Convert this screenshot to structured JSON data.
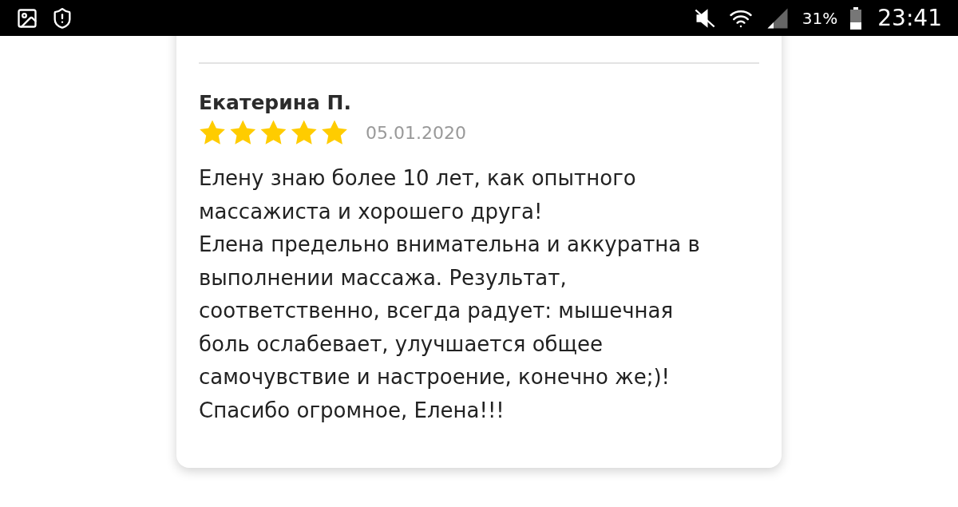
{
  "status_bar": {
    "battery": "31%",
    "time": "23:41"
  },
  "review": {
    "author": "Екатерина П.",
    "stars": 5,
    "date": "05.01.2020",
    "paragraphs": [
      "Елену знаю более 10 лет, как опытного массажиста и хорошего друга!",
      "Елена предельно внимательна и аккуратна в выполнении массажа. Результат, соответственно, всегда радует: мышечная боль ослабевает, улучшается общее самочувствие и настроение, конечно же;)!",
      "Спасибо огромное, Елена!!!"
    ]
  }
}
